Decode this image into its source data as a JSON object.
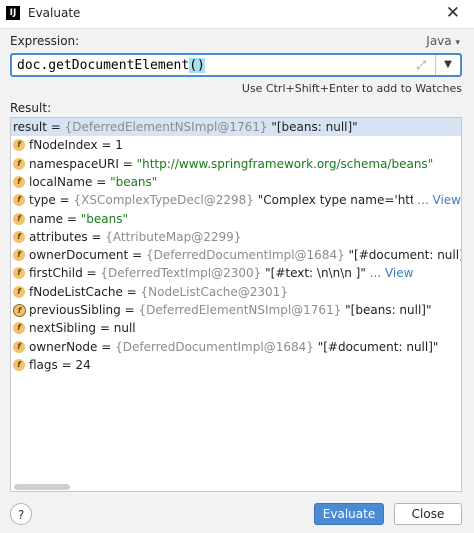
{
  "window": {
    "title": "Evaluate",
    "app_icon": "intellij-icon",
    "close_glyph": "✕"
  },
  "expression": {
    "label": "Expression:",
    "language": "Java",
    "value_prefix": "doc.getDocumentElement",
    "value_paren": "()",
    "hint": "Use Ctrl+Shift+Enter to add to Watches"
  },
  "result": {
    "label": "Result:",
    "root": {
      "name": "result",
      "eq": " = ",
      "ref": "{DeferredElementNSImpl@1761}",
      "value": " \"[beans: null]\""
    },
    "fields": [
      {
        "badge": "f",
        "name": "fNodeIndex",
        "eq": " = ",
        "ref": "",
        "value": "1",
        "link": ""
      },
      {
        "badge": "f",
        "name": "namespaceURI",
        "eq": " = ",
        "ref": "",
        "value": "\"http://www.springframework.org/schema/beans\"",
        "link": ""
      },
      {
        "badge": "f",
        "name": "localName",
        "eq": " = ",
        "ref": "",
        "value": "\"beans\"",
        "link": ""
      },
      {
        "badge": "f",
        "name": "type",
        "eq": " = ",
        "ref": "{XSComplexTypeDecl@2298}",
        "value": " \"Complex type name='http://www.spri",
        "link": "... View"
      },
      {
        "badge": "f",
        "name": "name",
        "eq": " = ",
        "ref": "",
        "value": "\"beans\"",
        "link": ""
      },
      {
        "badge": "f",
        "name": "attributes",
        "eq": " = ",
        "ref": "{AttributeMap@2299}",
        "value": "",
        "link": ""
      },
      {
        "badge": "f",
        "name": "ownerDocument",
        "eq": " = ",
        "ref": "{DeferredDocumentImpl@1684}",
        "value": " \"[#document: null]\"",
        "link": ""
      },
      {
        "badge": "f",
        "name": "firstChild",
        "eq": " = ",
        "ref": "{DeferredTextImpl@2300}",
        "value": " \"[#text: \\n\\n\\n    ]\"",
        "link": "... View"
      },
      {
        "badge": "f",
        "name": "fNodeListCache",
        "eq": " = ",
        "ref": "{NodeListCache@2301}",
        "value": "",
        "link": ""
      },
      {
        "badge": "f",
        "name": "previousSibling",
        "eq": " = ",
        "ref": "{DeferredElementNSImpl@1761}",
        "value": " \"[beans: null]\"",
        "link": ""
      },
      {
        "badge": "f",
        "name": "nextSibling",
        "eq": " = ",
        "ref": "",
        "value": "null",
        "link": ""
      },
      {
        "badge": "f",
        "name": "ownerNode",
        "eq": " = ",
        "ref": "{DeferredDocumentImpl@1684}",
        "value": " \"[#document: null]\"",
        "link": ""
      },
      {
        "badge": "f",
        "name": "flags",
        "eq": " = ",
        "ref": "",
        "value": "24",
        "link": ""
      }
    ]
  },
  "buttons": {
    "help": "?",
    "evaluate": "Evaluate",
    "close": "Close"
  },
  "colors": {
    "accent": "#4a8bd4",
    "selection": "#d5e3f3",
    "field_badge": "#f1c16e",
    "string_value": "#1a7a1a",
    "link": "#3d78c5"
  }
}
